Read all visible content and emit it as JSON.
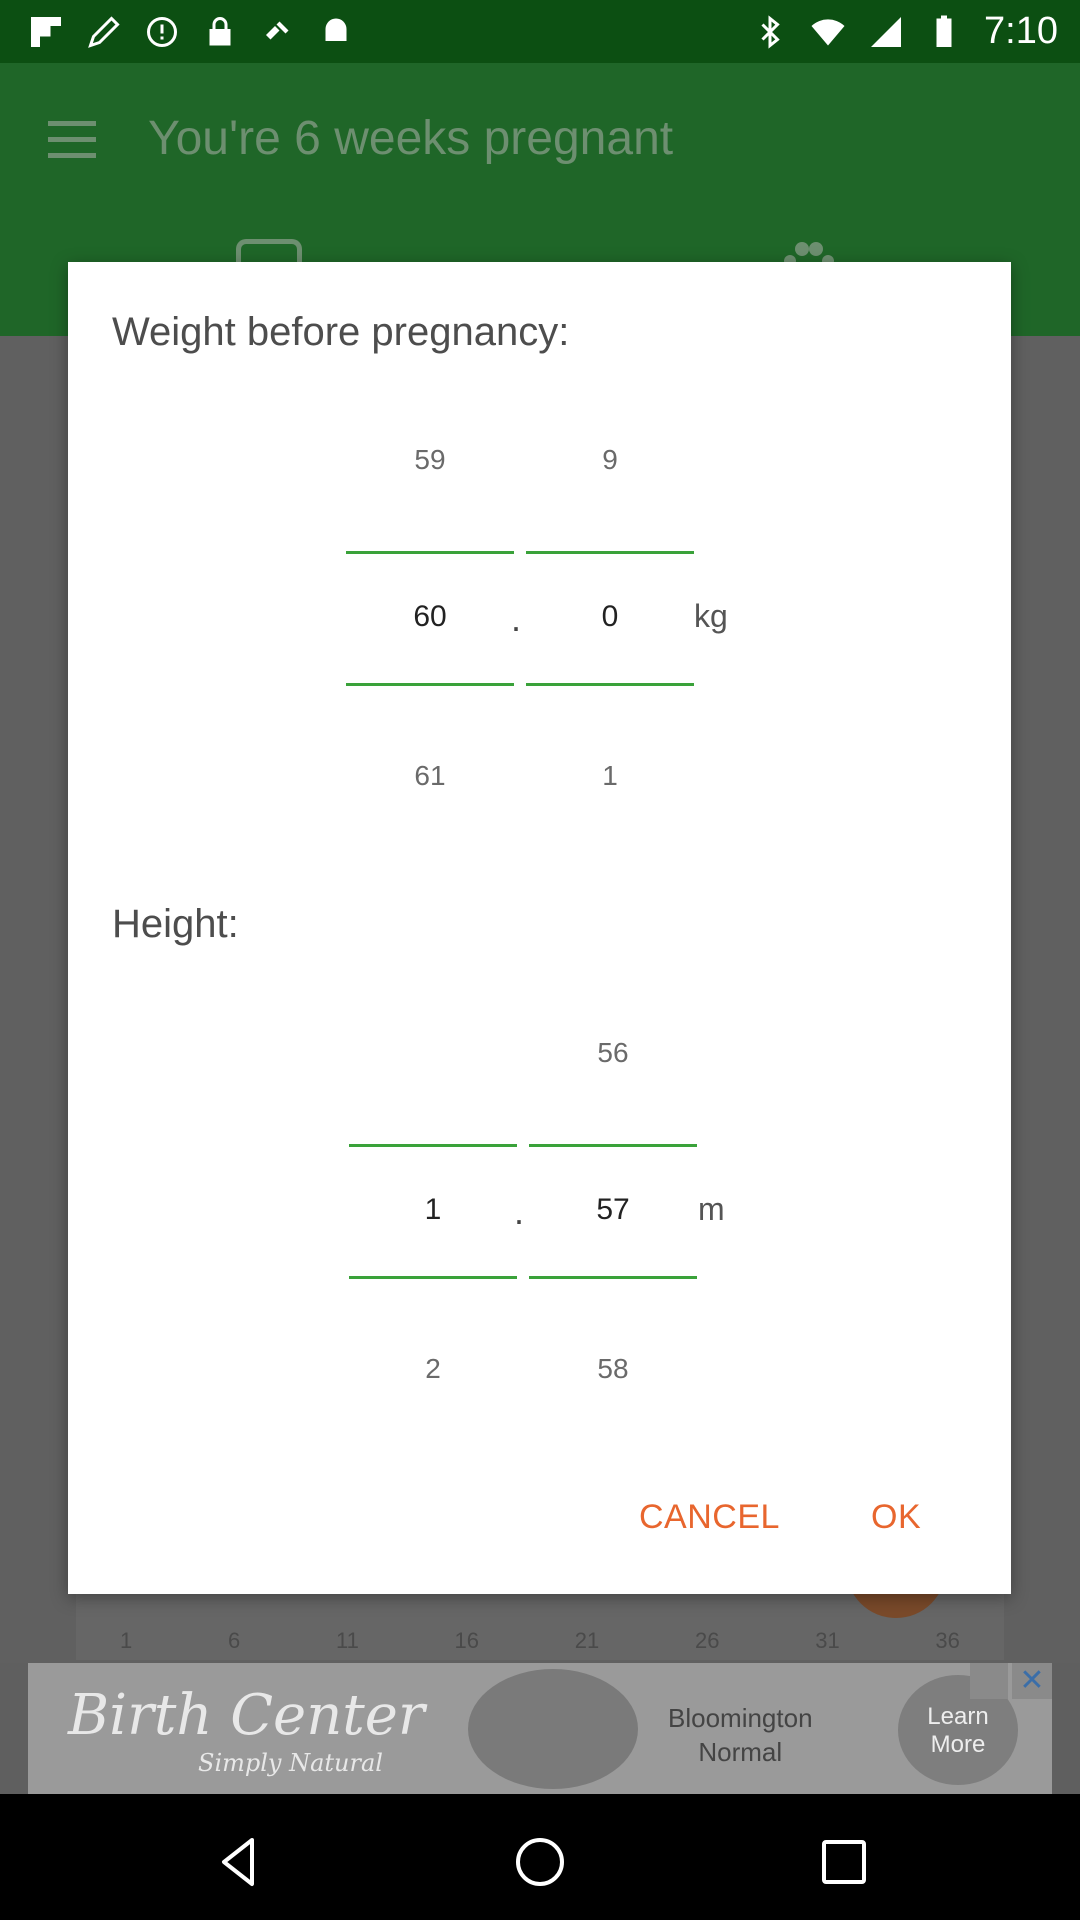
{
  "status_bar": {
    "time": "7:10",
    "left_icons": [
      "flipboard-icon",
      "edit-icon",
      "data-saver-icon",
      "lock-icon",
      "fake-gps-icon",
      "android-icon"
    ],
    "right_icons": [
      "bluetooth-icon",
      "wifi-icon",
      "signal-icon",
      "battery-icon"
    ]
  },
  "app_bar": {
    "title": "You're 6 weeks pregnant"
  },
  "dialog": {
    "weight": {
      "heading": "Weight before pregnancy:",
      "integer": {
        "prev": "59",
        "selected": "60",
        "next": "61"
      },
      "decimal": {
        "prev": "9",
        "selected": "0",
        "next": "1"
      },
      "separator": ".",
      "unit": "kg"
    },
    "height": {
      "heading": "Height:",
      "integer": {
        "prev": "",
        "selected": "1",
        "next": "2"
      },
      "decimal": {
        "prev": "56",
        "selected": "57",
        "next": "58"
      },
      "separator": ".",
      "unit": "m"
    },
    "cancel_label": "CANCEL",
    "ok_label": "OK"
  },
  "background": {
    "scale": [
      "1",
      "6",
      "11",
      "16",
      "21",
      "26",
      "31",
      "36"
    ]
  },
  "ad": {
    "brand": "Birth Center",
    "tagline": "Simply Natural",
    "location_line1": "Bloomington",
    "location_line2": "Normal",
    "cta": "Learn More"
  },
  "colors": {
    "status_bar": "#0c4f12",
    "app_bar_dimmed": "#1f6628",
    "accent_green": "#3aa23a",
    "button_orange": "#e8662e"
  }
}
